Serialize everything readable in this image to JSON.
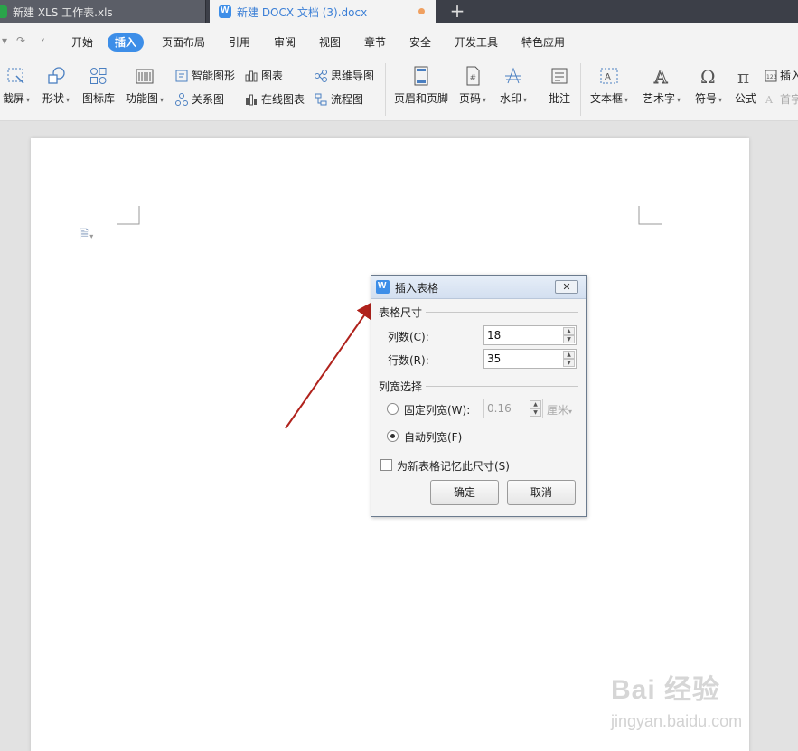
{
  "tabs": [
    {
      "label": "新建 XLS 工作表.xls"
    },
    {
      "label": "新建 DOCX 文档 (3).docx"
    }
  ],
  "menu": {
    "items": [
      "开始",
      "插入",
      "页面布局",
      "引用",
      "审阅",
      "视图",
      "章节",
      "安全",
      "开发工具",
      "特色应用"
    ],
    "active": "插入"
  },
  "ribbon": {
    "screenshot": "截屏",
    "shapes": "形状",
    "icon_library": "图标库",
    "function_chart": "功能图",
    "smart_art": "智能图形",
    "chart": "图表",
    "mind_map": "思维导图",
    "relation_chart": "关系图",
    "online_chart": "在线图表",
    "flowchart": "流程图",
    "header_footer": "页眉和页脚",
    "page_number": "页码",
    "watermark": "水印",
    "comment": "批注",
    "text_box": "文本框",
    "word_art": "艺术字",
    "symbol": "符号",
    "formula": "公式",
    "insert_number": "插入",
    "dropcap": "首字"
  },
  "dialog": {
    "title": "插入表格",
    "close_glyph": "✕",
    "section_size": "表格尺寸",
    "columns_label": "列数(C):",
    "columns_value": "18",
    "rows_label": "行数(R):",
    "rows_value": "35",
    "section_width": "列宽选择",
    "fixed_width_label": "固定列宽(W):",
    "fixed_width_value": "0.16",
    "fixed_width_unit": "厘米",
    "auto_width_label": "自动列宽(F)",
    "remember_label": "为新表格记忆此尺寸(S)",
    "ok_label": "确定",
    "cancel_label": "取消",
    "selected_width_option": "auto",
    "remember_checked": false
  },
  "watermark": {
    "logo": "Bai 经验",
    "url": "jingyan.baidu.com"
  },
  "colors": {
    "accent": "#3d8ee8",
    "arrow": "#b0221c",
    "tabbar": "#3c3f48"
  }
}
